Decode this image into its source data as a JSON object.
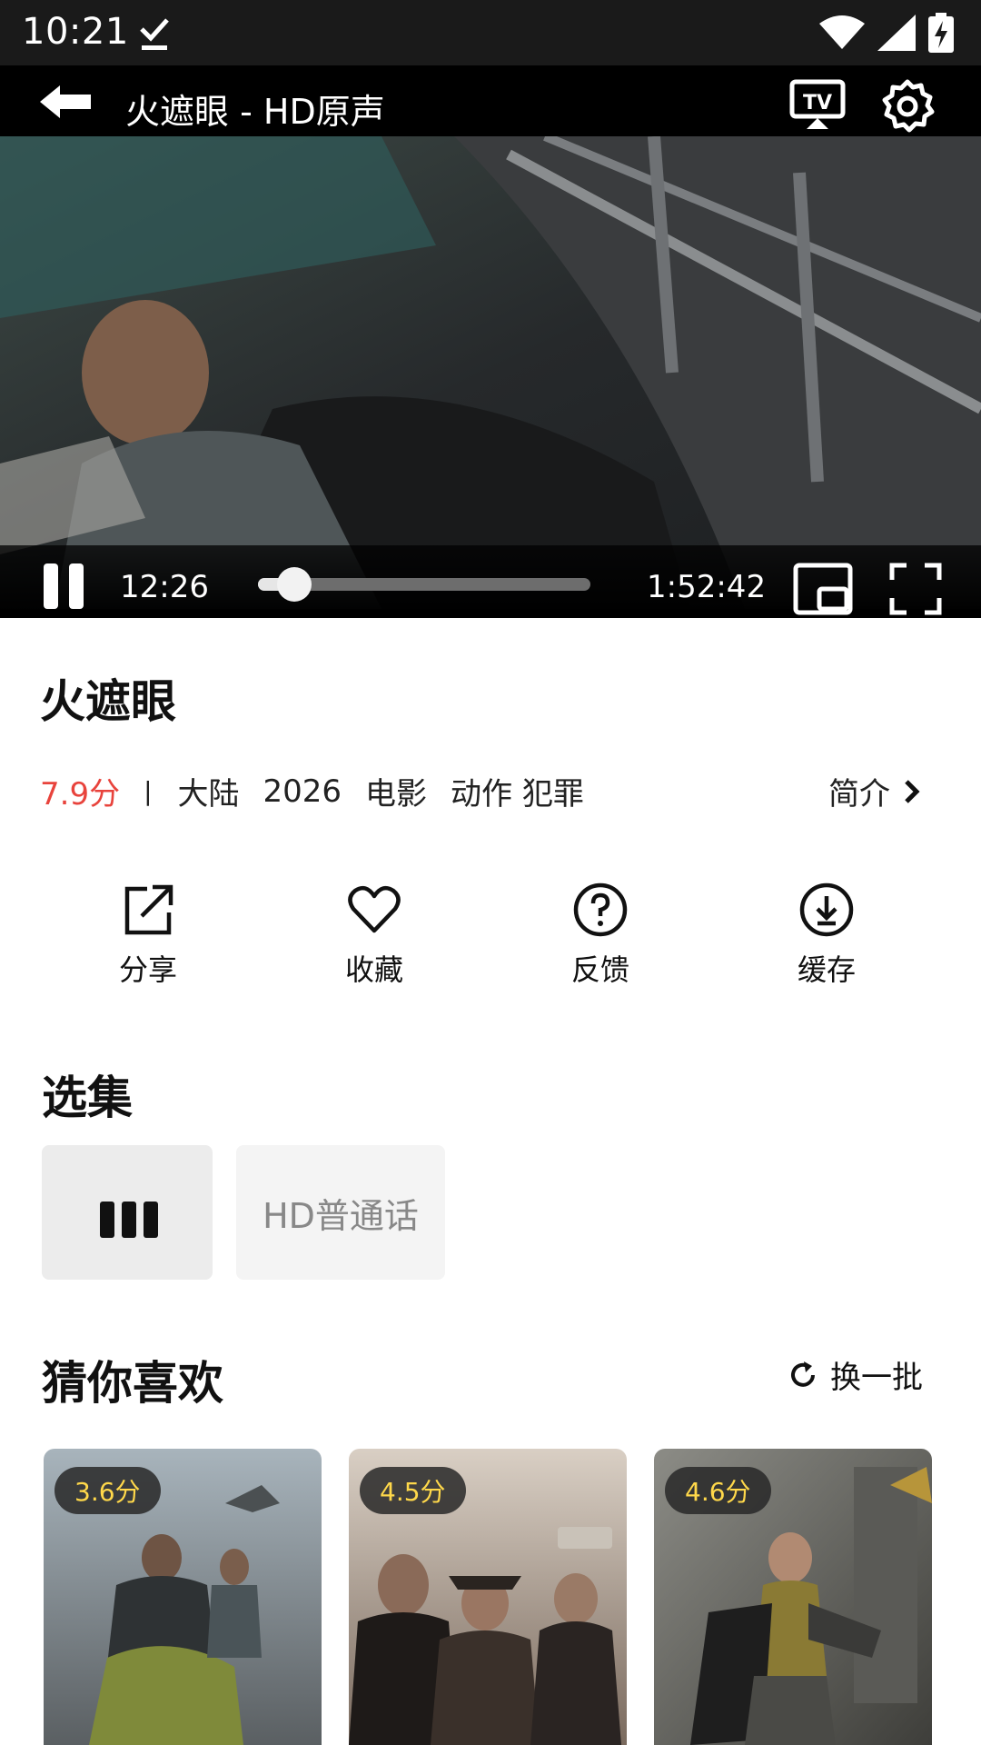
{
  "status_bar": {
    "time": "10:21",
    "icons": [
      "download-done-icon",
      "wifi-icon",
      "signal-icon",
      "battery-charging-icon"
    ]
  },
  "player": {
    "title": "火遮眼 - HD原声",
    "current_time": "12:26",
    "total_time": "1:52:42",
    "progress_fraction": 0.11,
    "icons": [
      "back-arrow-icon",
      "tv-cast-icon",
      "gear-icon",
      "pause-icon",
      "pip-icon",
      "fullscreen-icon"
    ]
  },
  "movie": {
    "title": "火遮眼",
    "score": "7.9分",
    "separator": "|",
    "region": "大陆",
    "year": "2026",
    "type": "电影",
    "genres": "动作 犯罪",
    "intro_label": "简介"
  },
  "actions": [
    {
      "label": "分享",
      "icon": "share-icon"
    },
    {
      "label": "收藏",
      "icon": "heart-icon"
    },
    {
      "label": "反馈",
      "icon": "help-circle-icon"
    },
    {
      "label": "缓存",
      "icon": "download-circle-icon"
    }
  ],
  "episodes": {
    "title": "选集",
    "items": [
      "HD普通话"
    ]
  },
  "recommend": {
    "title": "猜你喜欢",
    "refresh_label": "换一批",
    "cards": [
      {
        "score": "3.6分"
      },
      {
        "score": "4.5分"
      },
      {
        "score": "4.6分"
      }
    ]
  },
  "colors": {
    "accent_red": "#e8433c",
    "badge_text": "#ffd84a",
    "player_bg": "#000000"
  }
}
